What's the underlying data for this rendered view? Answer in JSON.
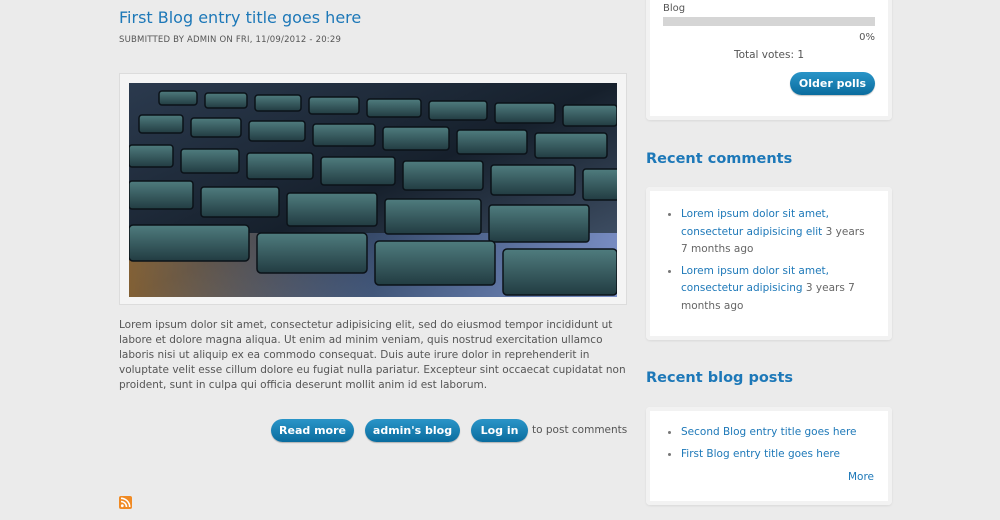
{
  "article": {
    "title": "First Blog entry title goes here",
    "submitted": "SUBMITTED BY ADMIN ON FRI, 11/09/2012 - 20:29",
    "image_icon": "laptop-keyboard-photo",
    "body": "Lorem ipsum dolor sit amet, consectetur adipisicing elit, sed do eiusmod tempor incididunt ut labore et dolore magna aliqua. Ut enim ad minim veniam, quis nostrud exercitation ullamco laboris nisi ut aliquip ex ea commodo consequat. Duis aute irure dolor in reprehenderit in voluptate velit esse cillum dolore eu fugiat nulla pariatur. Excepteur sint occaecat cupidatat non proident, sunt in culpa qui officia deserunt mollit anim id est laborum.",
    "links": {
      "read_more": "Read more",
      "admins_blog": "admin's blog",
      "log_in": "Log in",
      "post_comments_suffix": "to post comments"
    }
  },
  "rss_icon": "rss-feed-icon",
  "poll": {
    "choice_label": "Blog",
    "percent": "0%",
    "percent_value": 0,
    "total_votes": "Total votes: 1",
    "older_polls": "Older polls"
  },
  "recent_comments": {
    "title": "Recent comments",
    "items": [
      {
        "link": "Lorem ipsum dolor sit amet, consectetur adipisicing elit",
        "age": "3 years 7 months ago"
      },
      {
        "link": "Lorem ipsum dolor sit amet, consectetur adipisicing",
        "age": "3 years 7 months ago"
      }
    ]
  },
  "recent_posts": {
    "title": "Recent blog posts",
    "items": [
      {
        "link": "Second Blog entry title goes here"
      },
      {
        "link": "First Blog entry title goes here"
      }
    ],
    "more": "More"
  },
  "colors": {
    "accent": "#1d78b8",
    "button": "#0a6c9e",
    "background": "#ebebeb"
  }
}
